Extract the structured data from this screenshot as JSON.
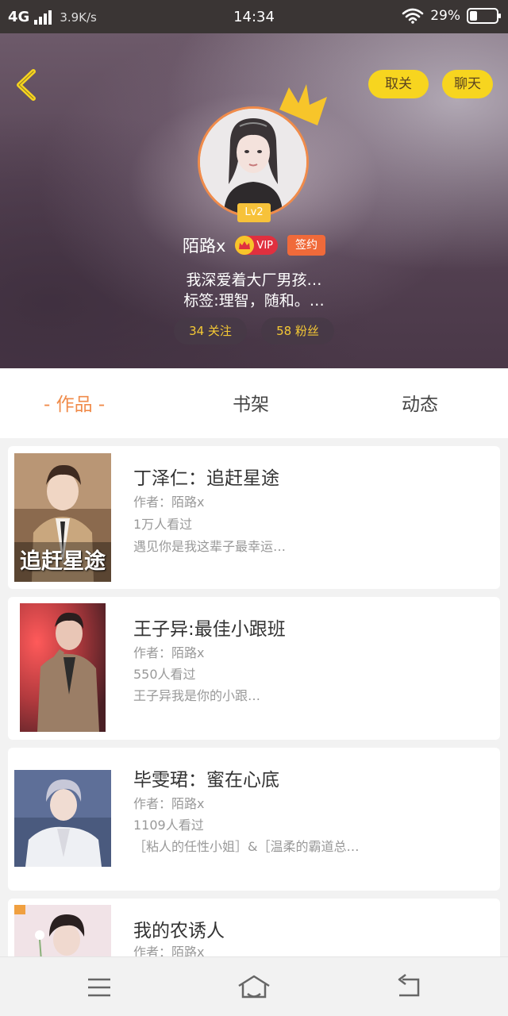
{
  "status_bar": {
    "network": "4G",
    "speed": "3.9K/s",
    "time": "14:34",
    "battery": "29%",
    "battery_level": 0.29
  },
  "header": {
    "unfollow_label": "取关",
    "chat_label": "聊天",
    "level": "Lv2",
    "username": "陌路x",
    "vip_label": "VIP",
    "signed_label": "签约",
    "bio_line1": "我深爱着大厂男孩…",
    "bio_line2": "标签:理智，随和。…",
    "following": "34 关注",
    "fans": "58 粉丝"
  },
  "tabs": {
    "works": "- 作品 -",
    "bookshelf": "书架",
    "feed": "动态"
  },
  "books": [
    {
      "title": "丁泽仁：追赶星途",
      "author": "作者：陌路x",
      "views": "1万人看过",
      "desc": "遇见你是我这辈子最幸运…",
      "cover_text": "追赶星途"
    },
    {
      "title": "王子异:最佳小跟班",
      "author": "作者：陌路x",
      "views": "550人看过",
      "desc": "王子异我是你的小跟…"
    },
    {
      "title": "毕雯珺：蜜在心底",
      "author": "作者：陌路x",
      "views": "1109人看过",
      "desc": "［粘人的任性小姐］&［温柔的霸道总…"
    },
    {
      "title": "我的农诱人",
      "author": "作者：陌路x"
    }
  ],
  "colors": {
    "accent": "#f08b4a",
    "pill_yellow": "#f7d51f",
    "stat_text": "#f5c934"
  },
  "nav": {
    "menu_icon": "menu-icon",
    "home_icon": "home-icon",
    "back_icon": "back-icon"
  }
}
